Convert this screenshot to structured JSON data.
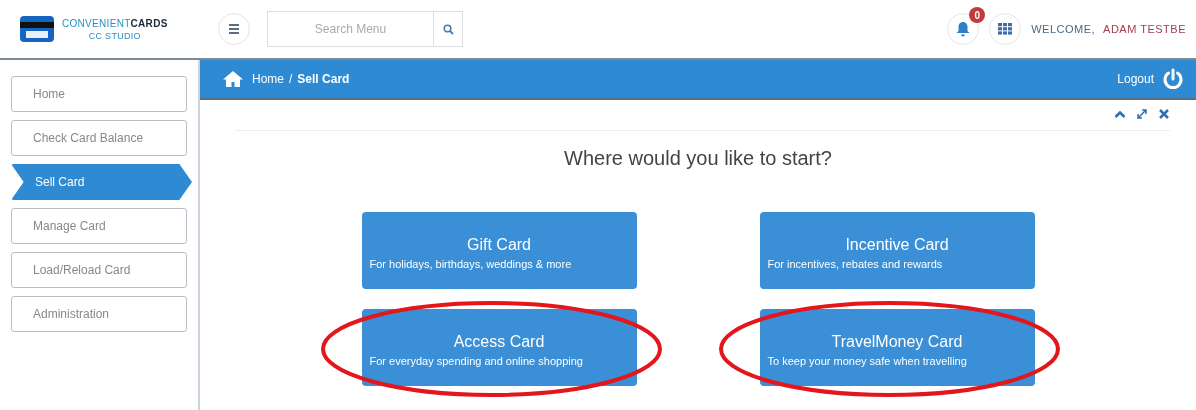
{
  "header": {
    "logo": {
      "brand_light": "CONVENIENT",
      "brand_bold": "CARDS",
      "subtitle": "CC STUDIO"
    },
    "search": {
      "placeholder": "Search Menu"
    },
    "notifications": {
      "count": "0"
    },
    "welcome": "WELCOME,",
    "user": "ADAM TESTBE"
  },
  "sidebar": {
    "items": [
      {
        "label": "Home",
        "selected": false
      },
      {
        "label": "Check Card Balance",
        "selected": false
      },
      {
        "label": "Sell Card",
        "selected": true
      },
      {
        "label": "Manage Card",
        "selected": false
      },
      {
        "label": "Load/Reload Card",
        "selected": false
      },
      {
        "label": "Administration",
        "selected": false
      }
    ]
  },
  "breadcrumb": {
    "items": [
      "Home",
      "Sell Card"
    ],
    "separator": "/"
  },
  "logout": "Logout",
  "heading": "Where would you like to start?",
  "cards": [
    {
      "title": "Gift Card",
      "subtitle": "For holidays, birthdays, weddings & more",
      "circled": false
    },
    {
      "title": "Incentive Card",
      "subtitle": "For incentives, rebates and rewards",
      "circled": false
    },
    {
      "title": "Access Card",
      "subtitle": "For everyday spending and online shopping",
      "circled": true
    },
    {
      "title": "TravelMoney Card",
      "subtitle": "To keep your money safe when travelling",
      "circled": true
    }
  ]
}
